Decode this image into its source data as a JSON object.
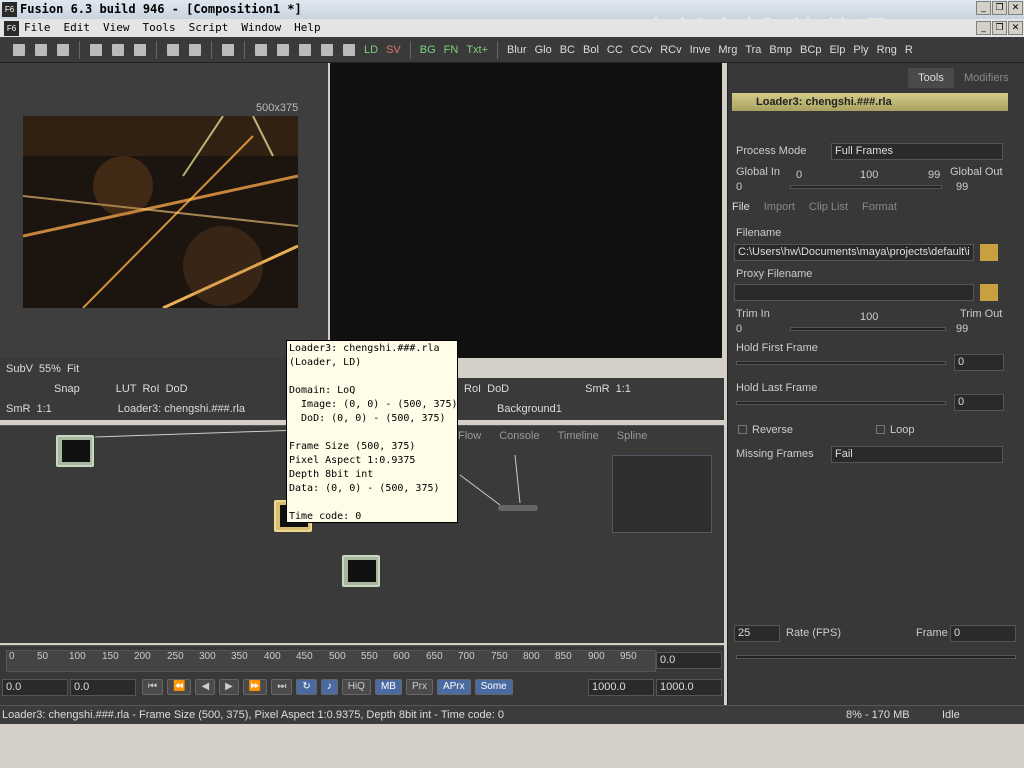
{
  "window": {
    "title": "Fusion 6.3 build 946 - [Composition1 *]",
    "app_icon": "F6",
    "watermark": "中新金桥 软件通"
  },
  "menu": [
    "File",
    "Edit",
    "View",
    "Tools",
    "Script",
    "Window",
    "Help"
  ],
  "toolbar": [
    "LD",
    "SV",
    "BG",
    "FN",
    "Txt+",
    "Blur",
    "Glo",
    "BC",
    "Bol",
    "CC",
    "CCv",
    "RCv",
    "Inve",
    "Mrg",
    "Tra",
    "Bmp",
    "BCp",
    "Elp",
    "Ply",
    "Rng",
    "R"
  ],
  "viewer_left": {
    "resolution": "500x375",
    "zoom": "55%",
    "fit": "Fit",
    "subv": "SubV",
    "snap": "Snap",
    "lut": "LUT",
    "roi": "RoI",
    "dod": "DoD",
    "smr": "SmR",
    "scale": "1:1",
    "label": "Loader3: chengshi.###.rla"
  },
  "viewer_right": {
    "roi": "RoI",
    "dod": "DoD",
    "smr": "SmR",
    "scale": "1:1",
    "label": "Background1"
  },
  "flow_tabs": [
    "Flow",
    "Console",
    "Timeline",
    "Spline"
  ],
  "tooltip": "Loader3: chengshi.###.rla\n(Loader, LD)\n\nDomain: LoQ\n  Image: (0, 0) - (500, 375)\n  DoD: (0, 0) - (500, 375)\n\nFrame Size (500, 375)\nPixel Aspect 1:0.9375\nDepth 8bit int\nData: (0, 0) - (500, 375)\n\nTime code: 0",
  "timeline": {
    "ticks": [
      "0",
      "50",
      "100",
      "150",
      "200",
      "250",
      "300",
      "350",
      "400",
      "450",
      "500",
      "550",
      "600",
      "650",
      "700",
      "750",
      "800",
      "850",
      "900",
      "950"
    ],
    "current": "0.0",
    "start": "0.0",
    "render_start": "0.0",
    "render_end": "1000.0",
    "end": "1000.0",
    "buttons": [
      "HiQ",
      "MB",
      "Prx",
      "APrx",
      "Some"
    ]
  },
  "status": {
    "text": "Loader3: chengshi.###.rla - Frame Size (500, 375), Pixel Aspect 1:0.9375, Depth 8bit int - Time code: 0",
    "memory": "8% - 170 MB",
    "state": "Idle"
  },
  "right_panel": {
    "tabs": [
      "Tools",
      "Modifiers"
    ],
    "tool_name": "Loader3: chengshi.###.rla",
    "process_mode_label": "Process Mode",
    "process_mode": "Full Frames",
    "global_in_label": "Global In",
    "global_in": "0",
    "global_out_label": "Global Out",
    "global_out": "99",
    "gslider_min": "0",
    "gslider_mid": "100",
    "gslider_max": "99",
    "subtabs": [
      "File",
      "Import",
      "Clip List",
      "Format"
    ],
    "filename_label": "Filename",
    "filename": "C:\\Users\\hw\\Documents\\maya\\projects\\default\\i",
    "proxy_label": "Proxy Filename",
    "trim_in_label": "Trim In",
    "trim_in": "0",
    "trim_out_label": "Trim Out",
    "trim_out": "99",
    "trim_mid": "100",
    "hold_first_label": "Hold First Frame",
    "hold_first": "0",
    "hold_last_label": "Hold Last Frame",
    "hold_last": "0",
    "reverse_label": "Reverse",
    "loop_label": "Loop",
    "missing_label": "Missing Frames",
    "missing": "Fail",
    "rate": "25",
    "rate_label": "Rate (FPS)",
    "frame_label": "Frame",
    "frame": "0"
  }
}
